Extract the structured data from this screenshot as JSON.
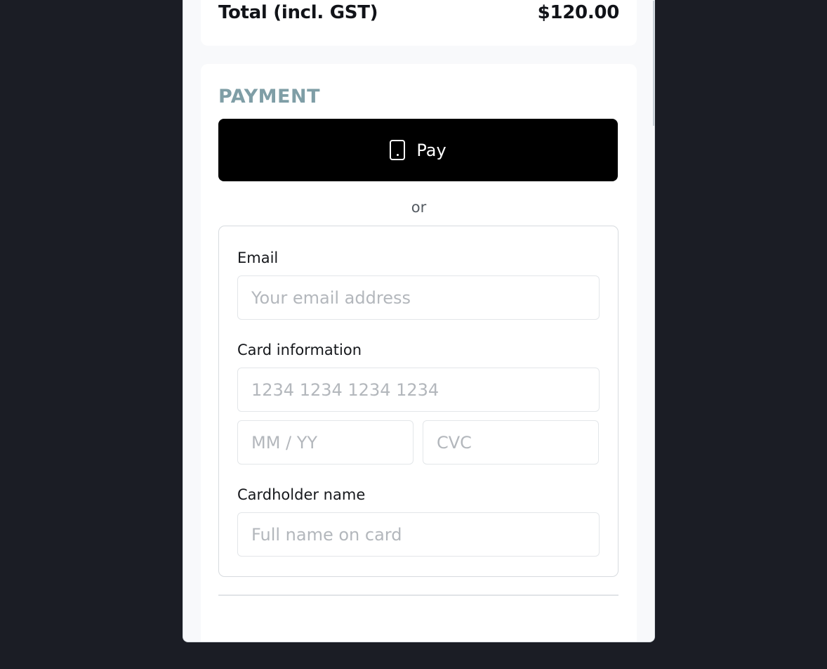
{
  "summary": {
    "total_label": "Total (incl. GST)",
    "total_value": "$120.00"
  },
  "payment": {
    "title": "PAYMENT",
    "pay_button": {
      "icon": "phone-icon",
      "label": "Pay"
    },
    "separator": "or",
    "form": {
      "email_label": "Email",
      "email_placeholder": "Your email address",
      "card_label": "Card information",
      "card_number_placeholder": "1234 1234 1234 1234",
      "expiry_placeholder": "MM / YY",
      "cvc_placeholder": "CVC",
      "cardholder_label": "Cardholder name",
      "cardholder_placeholder": "Full name on card"
    }
  },
  "colors": {
    "background": "#1b1d25",
    "section_title": "#7f9ea6",
    "pay_button": "#000000"
  }
}
